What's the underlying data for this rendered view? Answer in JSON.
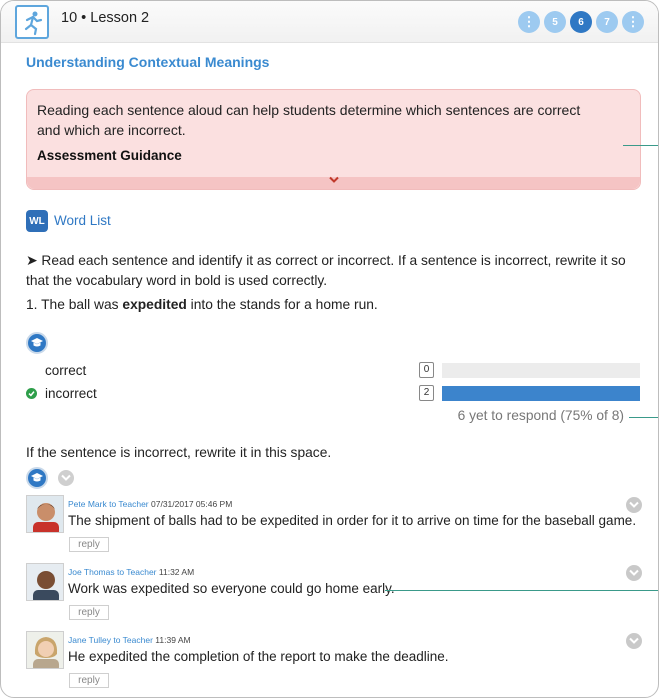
{
  "header": {
    "title": "10 • Lesson 2",
    "pager": [
      {
        "label": "⋮",
        "active": false
      },
      {
        "label": "5",
        "active": false
      },
      {
        "label": "6",
        "active": true
      },
      {
        "label": "7",
        "active": false
      },
      {
        "label": "⋮",
        "active": false
      }
    ]
  },
  "section_title": "Understanding Contextual Meanings",
  "guidance": {
    "text": "Reading each sentence aloud can help students determine which sentences are correct and which are incorrect.",
    "heading": "Assessment Guidance"
  },
  "word_list": {
    "badge": "WL",
    "label": "Word List"
  },
  "instructions": "➤ Read each sentence and identify it as correct or incorrect. If a sentence is incorrect, rewrite it so that the vocabulary word in bold is used correctly.",
  "question": {
    "prefix": "1. The ball was ",
    "bold": "expedited",
    "suffix": " into the stands for a home run."
  },
  "answers": [
    {
      "label": "correct",
      "count": "0",
      "fraction": 0.0,
      "is_correct": false
    },
    {
      "label": "incorrect",
      "count": "2",
      "fraction": 1.0,
      "is_correct": true
    }
  ],
  "respond_summary": "6 yet to respond (75% of 8)",
  "rewrite_prompt": "If the sentence is incorrect, rewrite it in this space.",
  "responses": [
    {
      "author": "Pete Mark to Teacher",
      "timestamp": "07/31/2017 05:46 PM",
      "text": "The shipment of balls had to be expedited in order for it to arrive on time for the baseball game.",
      "reply_label": "reply"
    },
    {
      "author": "Joe Thomas to Teacher",
      "timestamp": "11:32 AM",
      "text": "Work was expedited so everyone could go home early.",
      "reply_label": "reply"
    },
    {
      "author": "Jane Tulley to Teacher",
      "timestamp": "11:39 AM",
      "text": "He expedited the completion of the report to make the deadline.",
      "reply_label": "reply"
    }
  ],
  "colors": {
    "accent_blue": "#3a8ad0",
    "guidance_pink": "#fbe0e0",
    "bar_blue": "#3c84cc",
    "correct_green": "#2e9e4a",
    "pointer_line": "#3a9a8a"
  }
}
